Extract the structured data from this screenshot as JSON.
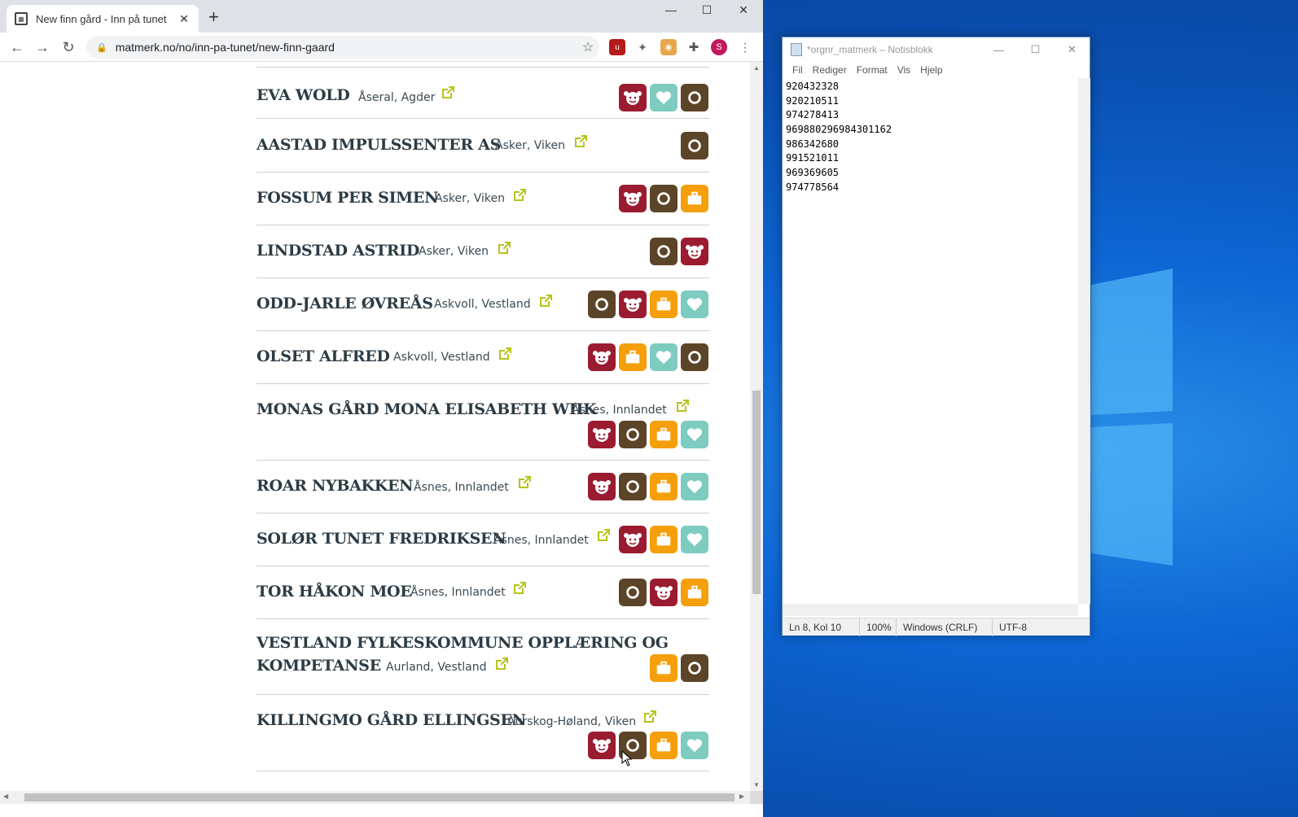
{
  "browser": {
    "tab_title": "New finn gård - Inn på tunet",
    "url": "matmerk.no/no/inn-pa-tunet/new-finn-gaard",
    "profile_initial": "S"
  },
  "farms": [
    {
      "name": "EVA WOLD",
      "location": "Åseral, Agder",
      "badges": [
        "red",
        "teal",
        "brown"
      ]
    },
    {
      "name": "AASTAD IMPULSSENTER AS",
      "location": "Asker, Viken",
      "badges": [
        "brown"
      ]
    },
    {
      "name": "FOSSUM PER SIMEN",
      "location": "Asker, Viken",
      "badges": [
        "red",
        "brown",
        "orange"
      ]
    },
    {
      "name": "LINDSTAD ASTRID",
      "location": "Asker, Viken",
      "badges": [
        "brown",
        "red"
      ]
    },
    {
      "name": "ODD-JARLE ØVREÅS",
      "location": "Askvoll, Vestland",
      "badges": [
        "brown",
        "red",
        "orange",
        "teal"
      ]
    },
    {
      "name": "OLSET ALFRED",
      "location": "Askvoll, Vestland",
      "badges": [
        "red",
        "orange",
        "teal",
        "brown"
      ]
    },
    {
      "name": "MONAS GÅRD MONA ELISABETH WIIK",
      "location": "Åsnes, Innlandet",
      "badges": [
        "red",
        "brown",
        "orange",
        "teal"
      ]
    },
    {
      "name": "ROAR NYBAKKEN",
      "location": "Åsnes, Innlandet",
      "badges": [
        "red",
        "brown",
        "orange",
        "teal"
      ]
    },
    {
      "name": "SOLØR TUNET FREDRIKSEN",
      "location": "Åsnes, Innlandet",
      "badges": [
        "red",
        "orange",
        "teal"
      ]
    },
    {
      "name": "TOR HÅKON MOE",
      "location": "Åsnes, Innlandet",
      "badges": [
        "brown",
        "red",
        "orange"
      ]
    },
    {
      "name_line1": "VESTLAND FYLKESKOMMUNE OPPLÆRING OG",
      "name_line2": "KOMPETANSE",
      "location": "Aurland, Vestland",
      "badges": [
        "orange",
        "brown"
      ]
    },
    {
      "name": "KILLINGMO GÅRD ELLINGSEN",
      "location": "Aurskog-Høland, Viken",
      "badges": [
        "red",
        "brown",
        "orange",
        "teal"
      ]
    }
  ],
  "notepad": {
    "title": "*orgnr_matmerk – Notisblokk",
    "menu": [
      "Fil",
      "Rediger",
      "Format",
      "Vis",
      "Hjelp"
    ],
    "lines": [
      "920432328",
      "920210511",
      "974278413",
      "969880296984301162",
      "986342680",
      "991521011",
      "969369605",
      "974778564"
    ],
    "status": {
      "position": "Ln 8, Kol 10",
      "zoom": "100%",
      "line_ending": "Windows (CRLF)",
      "encoding": "UTF-8"
    }
  },
  "colors": {
    "badge_red": "#9b1b30",
    "badge_brown": "#5b4427",
    "badge_orange": "#f59f0b",
    "badge_teal": "#7ecbc0",
    "link_icon": "#b5c41a"
  }
}
